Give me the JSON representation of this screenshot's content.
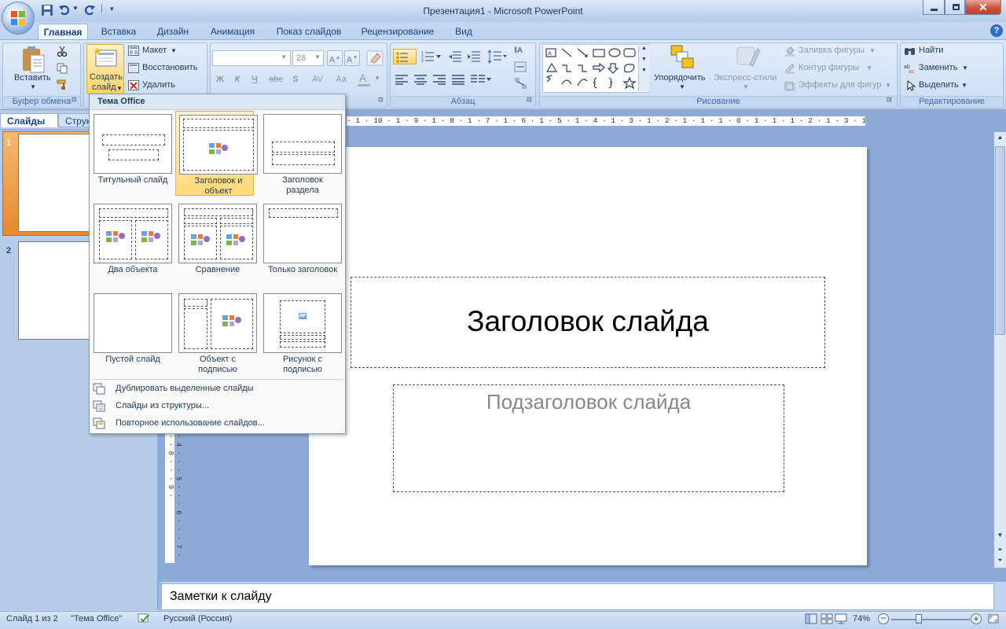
{
  "window": {
    "title": "Презентация1 - Microsoft PowerPoint"
  },
  "tabs": [
    "Главная",
    "Вставка",
    "Дизайн",
    "Анимация",
    "Показ слайдов",
    "Рецензирование",
    "Вид"
  ],
  "ribbon": {
    "clipboard": {
      "paste": "Вставить",
      "label": "Буфер обмена"
    },
    "slides": {
      "new_slide_line1": "Создать",
      "new_slide_line2": "слайд",
      "layout": "Макет",
      "reset": "Восстановить",
      "delete": "Удалить"
    },
    "font": {
      "size": "28",
      "bold": "Ж",
      "italic": "К",
      "underline": "Ч",
      "strike": "abc",
      "shadow": "S",
      "spacing": "AV",
      "case": "Aa"
    },
    "paragraph": {
      "label": "Абзац"
    },
    "drawing": {
      "arrange": "Упорядочить",
      "quick_styles": "Экспресс-стили",
      "fill": "Заливка фигуры",
      "outline": "Контур фигуры",
      "effects": "Эффекты для фигур",
      "label": "Рисование"
    },
    "editing": {
      "find": "Найти",
      "replace": "Заменить",
      "select": "Выделить",
      "label": "Редактирование"
    }
  },
  "left_pane": {
    "tab_slides": "Слайды",
    "tab_outline": "Струк",
    "slide_numbers": [
      "1",
      "2"
    ]
  },
  "dropdown": {
    "header": "Тема Office",
    "layouts": [
      {
        "name": "Титульный слайд",
        "line2": ""
      },
      {
        "name": "Заголовок и",
        "line2": "объект"
      },
      {
        "name": "Заголовок",
        "line2": "раздела"
      },
      {
        "name": "Два объекта",
        "line2": ""
      },
      {
        "name": "Сравнение",
        "line2": ""
      },
      {
        "name": "Только заголовок",
        "line2": ""
      },
      {
        "name": "Пустой слайд",
        "line2": ""
      },
      {
        "name": "Объект с",
        "line2": "подписью"
      },
      {
        "name": "Рисунок с",
        "line2": "подписью"
      }
    ],
    "items": [
      "Дублировать выделенные слайды",
      "Слайды из структуры...",
      "Повторное использование слайдов..."
    ]
  },
  "ruler": {
    "h_ticks": "· 1 · 10 · 1 · 9 · 1 · 8 · 1 · 7 · 1 · 6 · 1 · 5 · 1 · 4 · 1 · 3 · 1 · 2 · 1 · 1 · 1 · 0 · 1 · 1 · 1 · 2 · 1 · 3 · 1 · 4 · 1 · 5 · 1 · 6 · 1 · 7 · 1 · 8 · 1 · 9 · 1 · 10 · 1 · 11 · 1 · 12 · 1",
    "v_ticks": "· 4 · · · 5 · · · 6 · · · 7 · · · 8 · · · 9 ·"
  },
  "slide": {
    "title": "Заголовок слайда",
    "subtitle": "Подзаголовок слайда"
  },
  "notes": {
    "placeholder": "Заметки к слайду"
  },
  "status": {
    "slide": "Слайд 1 из 2",
    "theme": "\"Тема Office\"",
    "language": "Русский (Россия)",
    "zoom": "74%"
  },
  "colors": {
    "accent": "#15428b",
    "selected": "#ffd97a"
  }
}
